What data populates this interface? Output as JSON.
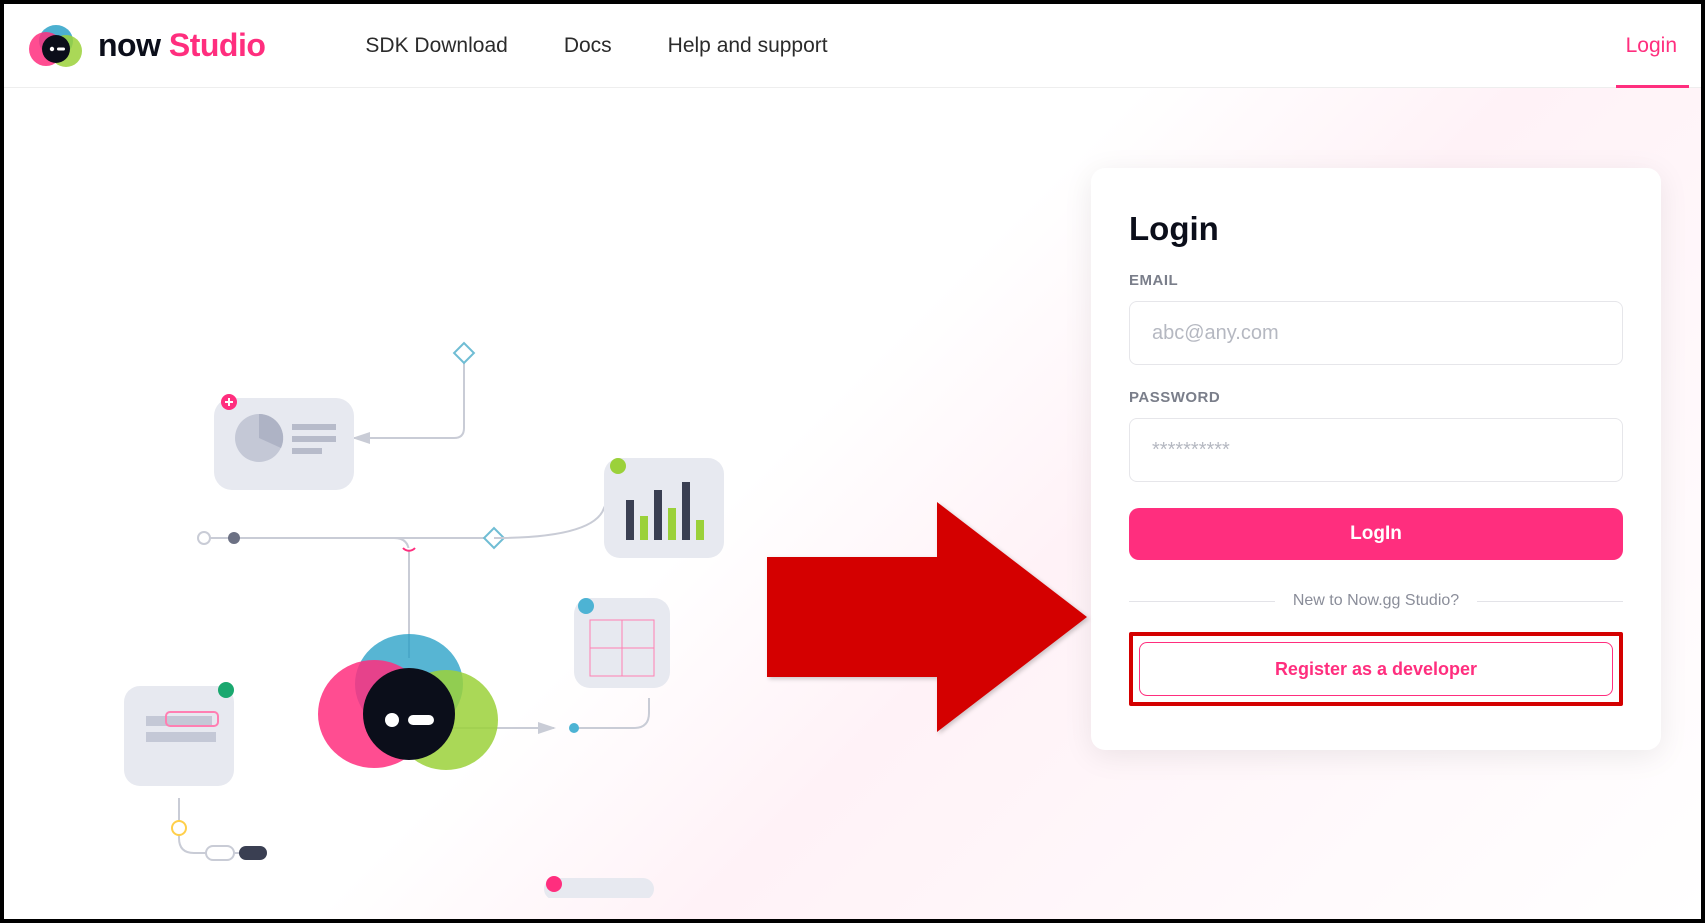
{
  "brand": {
    "name_part1": "now",
    "name_part2": " Studio"
  },
  "nav": {
    "sdk": "SDK Download",
    "docs": "Docs",
    "help": "Help and support"
  },
  "top_login": "Login",
  "card": {
    "title": "Login",
    "email_label": "EMAIL",
    "email_placeholder": "abc@any.com",
    "password_label": "PASSWORD",
    "password_placeholder": "**********",
    "submit": "LogIn",
    "separator": "New to Now.gg Studio?",
    "register": "Register as a developer"
  }
}
